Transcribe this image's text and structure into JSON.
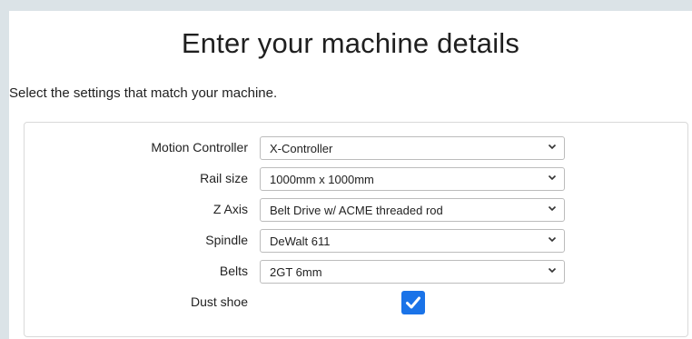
{
  "page": {
    "title": "Enter your machine details",
    "subtitle": "Select the settings that match your machine."
  },
  "form": {
    "fields": [
      {
        "label": "Motion Controller",
        "value": "X-Controller"
      },
      {
        "label": "Rail size",
        "value": "1000mm x 1000mm"
      },
      {
        "label": "Z Axis",
        "value": "Belt Drive w/ ACME threaded rod"
      },
      {
        "label": "Spindle",
        "value": "DeWalt 611"
      },
      {
        "label": "Belts",
        "value": "2GT 6mm"
      }
    ],
    "dust_shoe": {
      "label": "Dust shoe",
      "checked": true
    }
  },
  "colors": {
    "background": "#dbe3e7",
    "checkbox_accent": "#1a73e8"
  },
  "icons": {
    "select_arrow": "chevron-down-icon",
    "checkbox": "checkmark-icon"
  }
}
